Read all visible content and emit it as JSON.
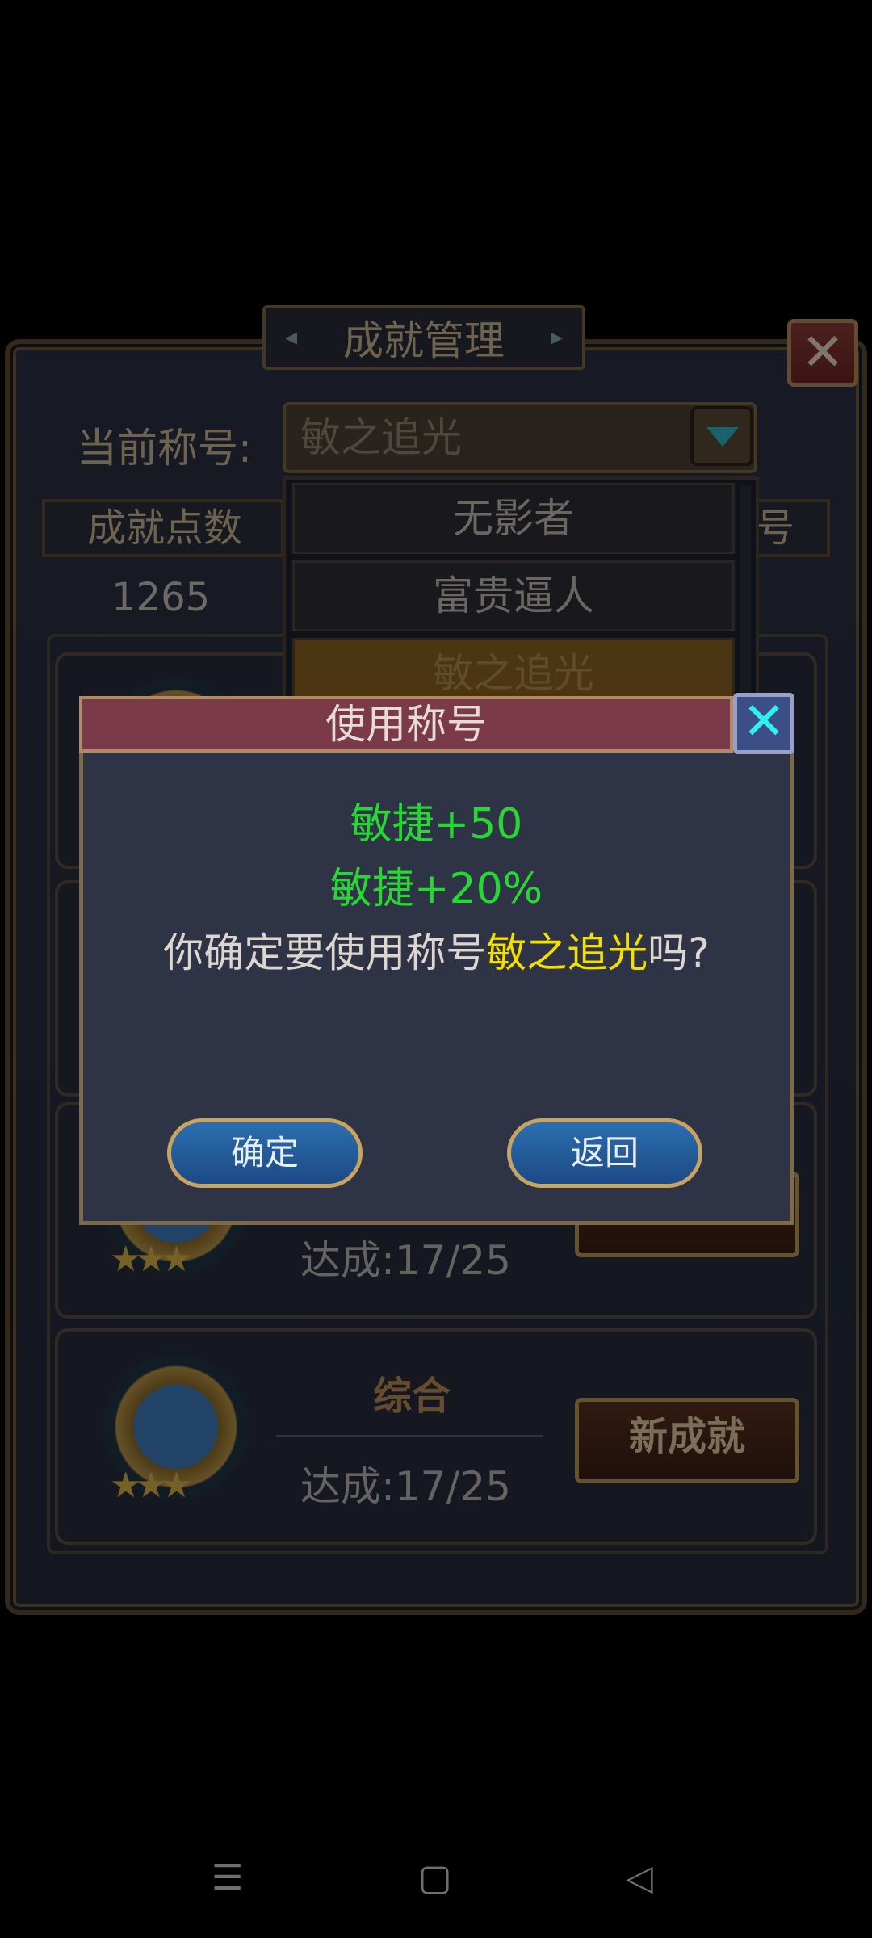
{
  "window": {
    "title": "成就管理",
    "close_icon": "close-icon"
  },
  "current_title": {
    "label": "当前称号:",
    "value": "敏之追光"
  },
  "stats": {
    "points_label": "成就点数",
    "points_value": "1265",
    "right_header_partial": "号"
  },
  "dropdown": {
    "items": [
      "无影者",
      "富贵逼人",
      "敏之追光"
    ],
    "selected": "敏之追光"
  },
  "cards": [
    {
      "category": "",
      "progress": "达成:17/25",
      "button": ""
    },
    {
      "category": "综合",
      "progress": "达成:17/25",
      "button": "新成就"
    }
  ],
  "dialog": {
    "title": "使用称号",
    "bonus_1": "敏捷+50",
    "bonus_2": "敏捷+20%",
    "confirm_prefix": "你确定要使用称号",
    "confirm_title": "敏之追光",
    "confirm_suffix": "吗?",
    "ok_label": "确定",
    "back_label": "返回"
  },
  "colors": {
    "bonus_green": "#27d832",
    "highlight_yellow": "#f4e000",
    "dialog_header": "#7a3a4a",
    "selected_item": "#8a6122"
  }
}
